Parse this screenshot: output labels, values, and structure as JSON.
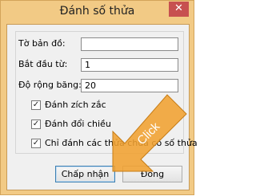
{
  "window": {
    "title": "Đánh số thửa",
    "close_glyph": "✕"
  },
  "form": {
    "map_sheet": {
      "label": "Tờ bản đồ:",
      "value": ""
    },
    "start_from": {
      "label": "Bắt đầu từ:",
      "value": "1"
    },
    "strip_width": {
      "label": "Độ rộng băng:",
      "value": "20"
    },
    "options": [
      {
        "label": "Đánh zích zắc",
        "checked": true
      },
      {
        "label": "Đánh đổi chiều",
        "checked": true
      },
      {
        "label": "Chỉ đánh các thửa chưa có số thửa",
        "checked": true
      }
    ]
  },
  "buttons": {
    "accept": "Chấp nhận",
    "close": "Đóng"
  },
  "callout": {
    "text": "Click",
    "color": "#f0a030"
  }
}
